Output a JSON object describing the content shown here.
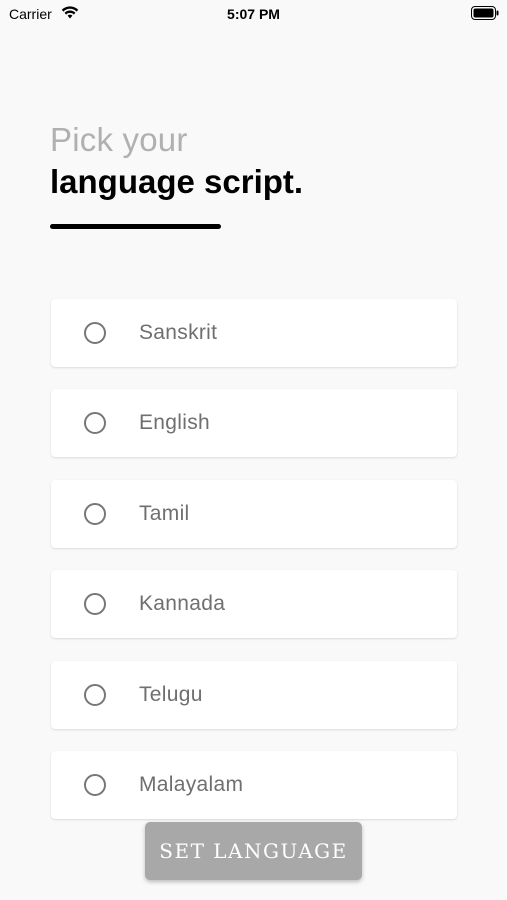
{
  "status_bar": {
    "carrier": "Carrier",
    "time": "5:07 PM"
  },
  "heading": {
    "line1": "Pick your",
    "line2": "language script."
  },
  "options": [
    {
      "label": "Sanskrit",
      "selected": false
    },
    {
      "label": "English",
      "selected": false
    },
    {
      "label": "Tamil",
      "selected": false
    },
    {
      "label": "Kannada",
      "selected": false
    },
    {
      "label": "Telugu",
      "selected": false
    },
    {
      "label": "Malayalam",
      "selected": false
    }
  ],
  "button": {
    "label": "SET LANGUAGE"
  },
  "colors": {
    "background": "#f9f9f9",
    "card": "#ffffff",
    "button": "#a8a8a8",
    "label": "#6f6f6f",
    "heading_light": "#b0b0b0"
  }
}
